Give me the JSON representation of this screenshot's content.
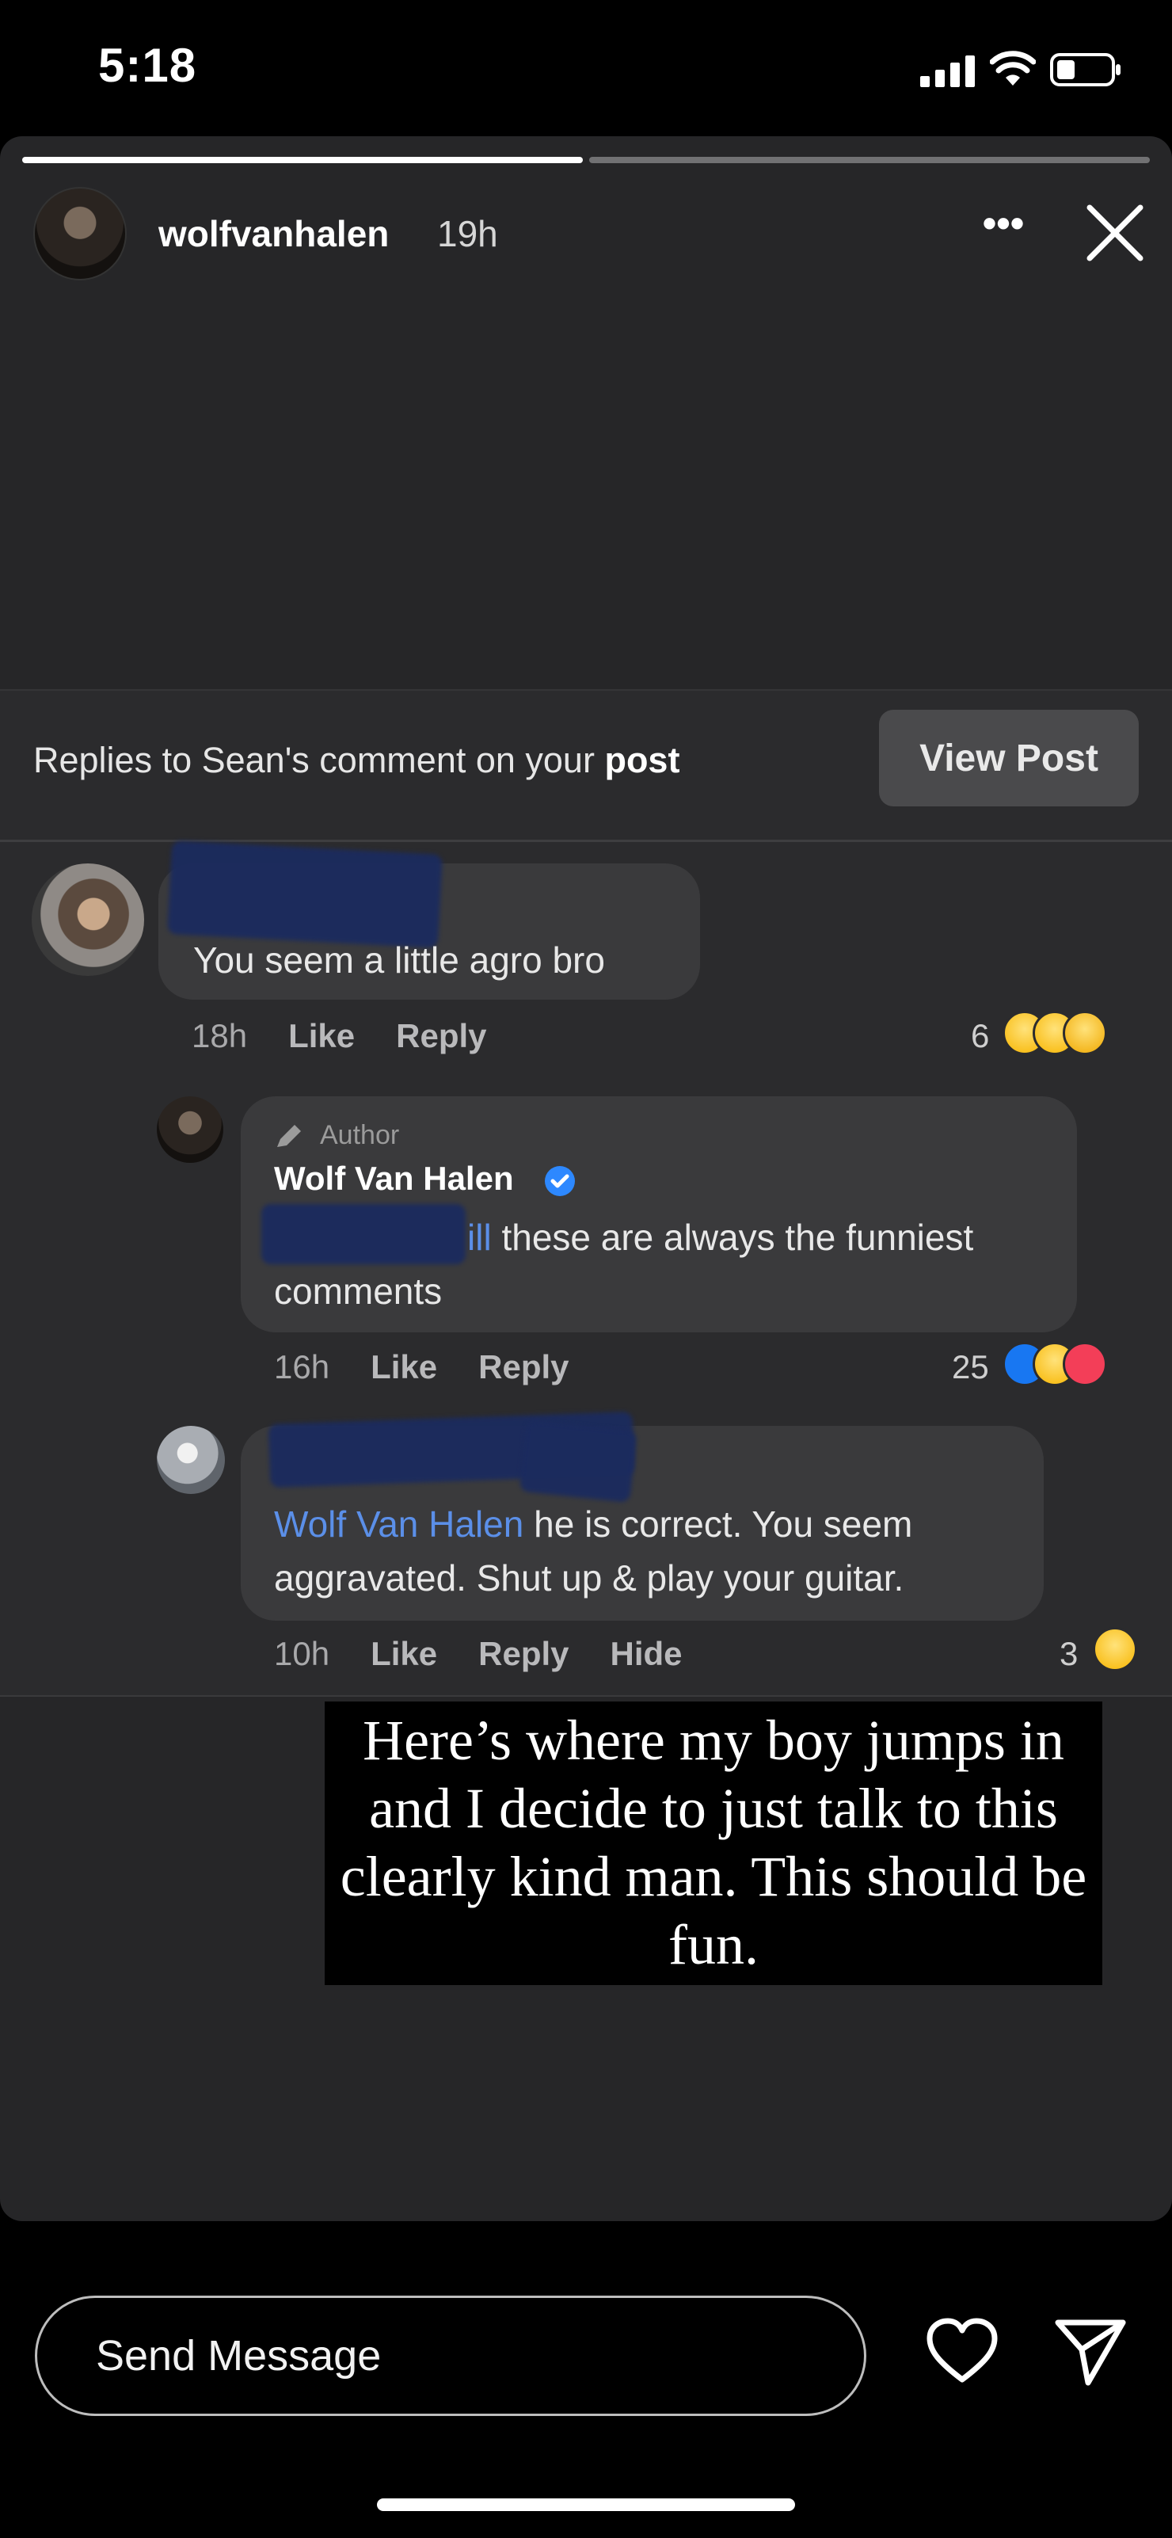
{
  "status_bar": {
    "time": "5:18"
  },
  "story": {
    "username": "wolfvanhalen",
    "time_ago": "19h",
    "more_label": "•••",
    "progress": {
      "segments": 2,
      "completed": 1
    }
  },
  "embedded": {
    "header_text_prefix": "Replies to Sean's comment on your ",
    "header_text_bold": "post",
    "view_post_label": "View Post",
    "comments": [
      {
        "text": "You seem a little agro bro",
        "time": "18h",
        "like": "Like",
        "reply": "Reply",
        "reaction_count": "6",
        "reactions": [
          "laugh-emoji",
          "wow-emoji",
          "sad-emoji"
        ]
      },
      {
        "author_label": "Author",
        "name": "Wolf Van Halen",
        "mention_fragment": "ill",
        "text": " these are always the funniest comments",
        "time": "16h",
        "like": "Like",
        "reply": "Reply",
        "reaction_count": "25",
        "reactions": [
          "like-emoji",
          "laugh-emoji",
          "love-emoji"
        ]
      },
      {
        "mention": "Wolf Van Halen",
        "text": " he is correct. You seem aggravated. Shut up & play your guitar.",
        "time": "10h",
        "like": "Like",
        "reply": "Reply",
        "hide": "Hide",
        "reaction_count": "3",
        "reactions": [
          "wow-emoji"
        ]
      }
    ]
  },
  "caption": "Here’s where my boy jumps in and I decide to just talk to this clearly kind man. This should be fun.",
  "composer": {
    "placeholder": "Send Message"
  },
  "colors": {
    "mention_blue": "#5b8fe8",
    "bubble": "#3a3a3c",
    "card": "#262628"
  }
}
